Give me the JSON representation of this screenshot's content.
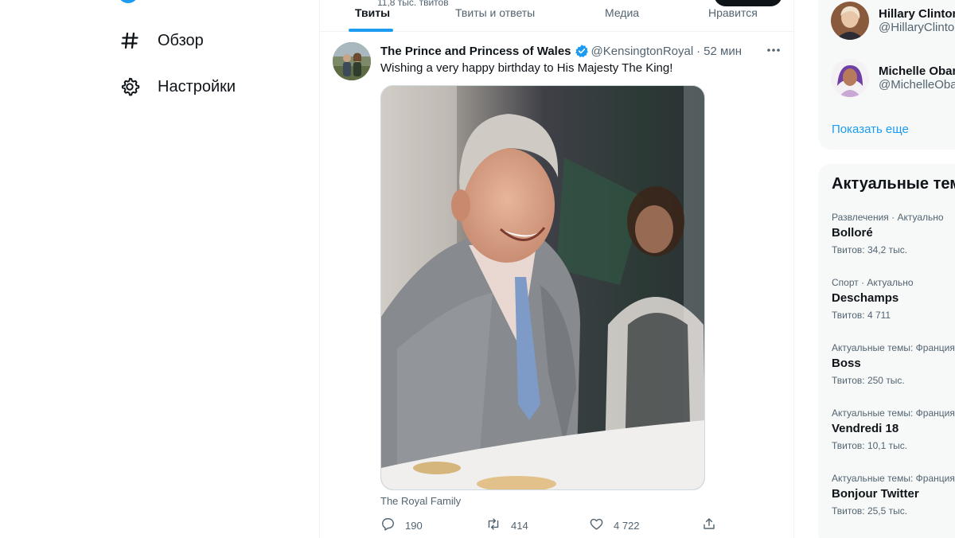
{
  "nav": {
    "items": [
      {
        "label": "Обзор",
        "icon": "hashtag-icon"
      },
      {
        "label": "Настройки",
        "icon": "gear-icon"
      }
    ]
  },
  "profile": {
    "tweet_count": "11,8 тыс. твитов"
  },
  "tabs": [
    "Твиты",
    "Твиты и ответы",
    "Медиа",
    "Нравится"
  ],
  "tweet": {
    "author_name": "The Prince and Princess of Wales",
    "handle": "@KensingtonRoyal",
    "separator": "·",
    "time": "52 мин",
    "text": "Wishing a very happy birthday to His Majesty The King!",
    "media_caption": "The Royal Family",
    "stats": {
      "replies": "190",
      "retweets": "414",
      "likes": "4 722"
    }
  },
  "who_to_follow": [
    {
      "name": "Hillary Clinton",
      "handle": "@HillaryClinton"
    },
    {
      "name": "Michelle Obama",
      "handle": "@MichelleObama"
    }
  ],
  "show_more": "Показать еще",
  "trends": {
    "title": "Актуальные темы",
    "items": [
      {
        "category": "Развлечения · Актуально",
        "title": "Bolloré",
        "count": "Твитов: 34,2 тыс."
      },
      {
        "category": "Спорт · Актуально",
        "title": "Deschamps",
        "count": "Твитов: 4 711"
      },
      {
        "category": "Актуальные темы: Франция",
        "title": "Boss",
        "count": "Твитов: 250 тыс."
      },
      {
        "category": "Актуальные темы: Франция",
        "title": "Vendredi 18",
        "count": "Твитов: 10,1 тыс."
      },
      {
        "category": "Актуальные темы: Франция",
        "title": "Bonjour Twitter",
        "count": "Твитов: 25,5 тыс."
      }
    ]
  },
  "colors": {
    "accent": "#1d9bf0",
    "text": "#0f1419",
    "secondary": "#536471",
    "panel": "#f7f9f9"
  }
}
